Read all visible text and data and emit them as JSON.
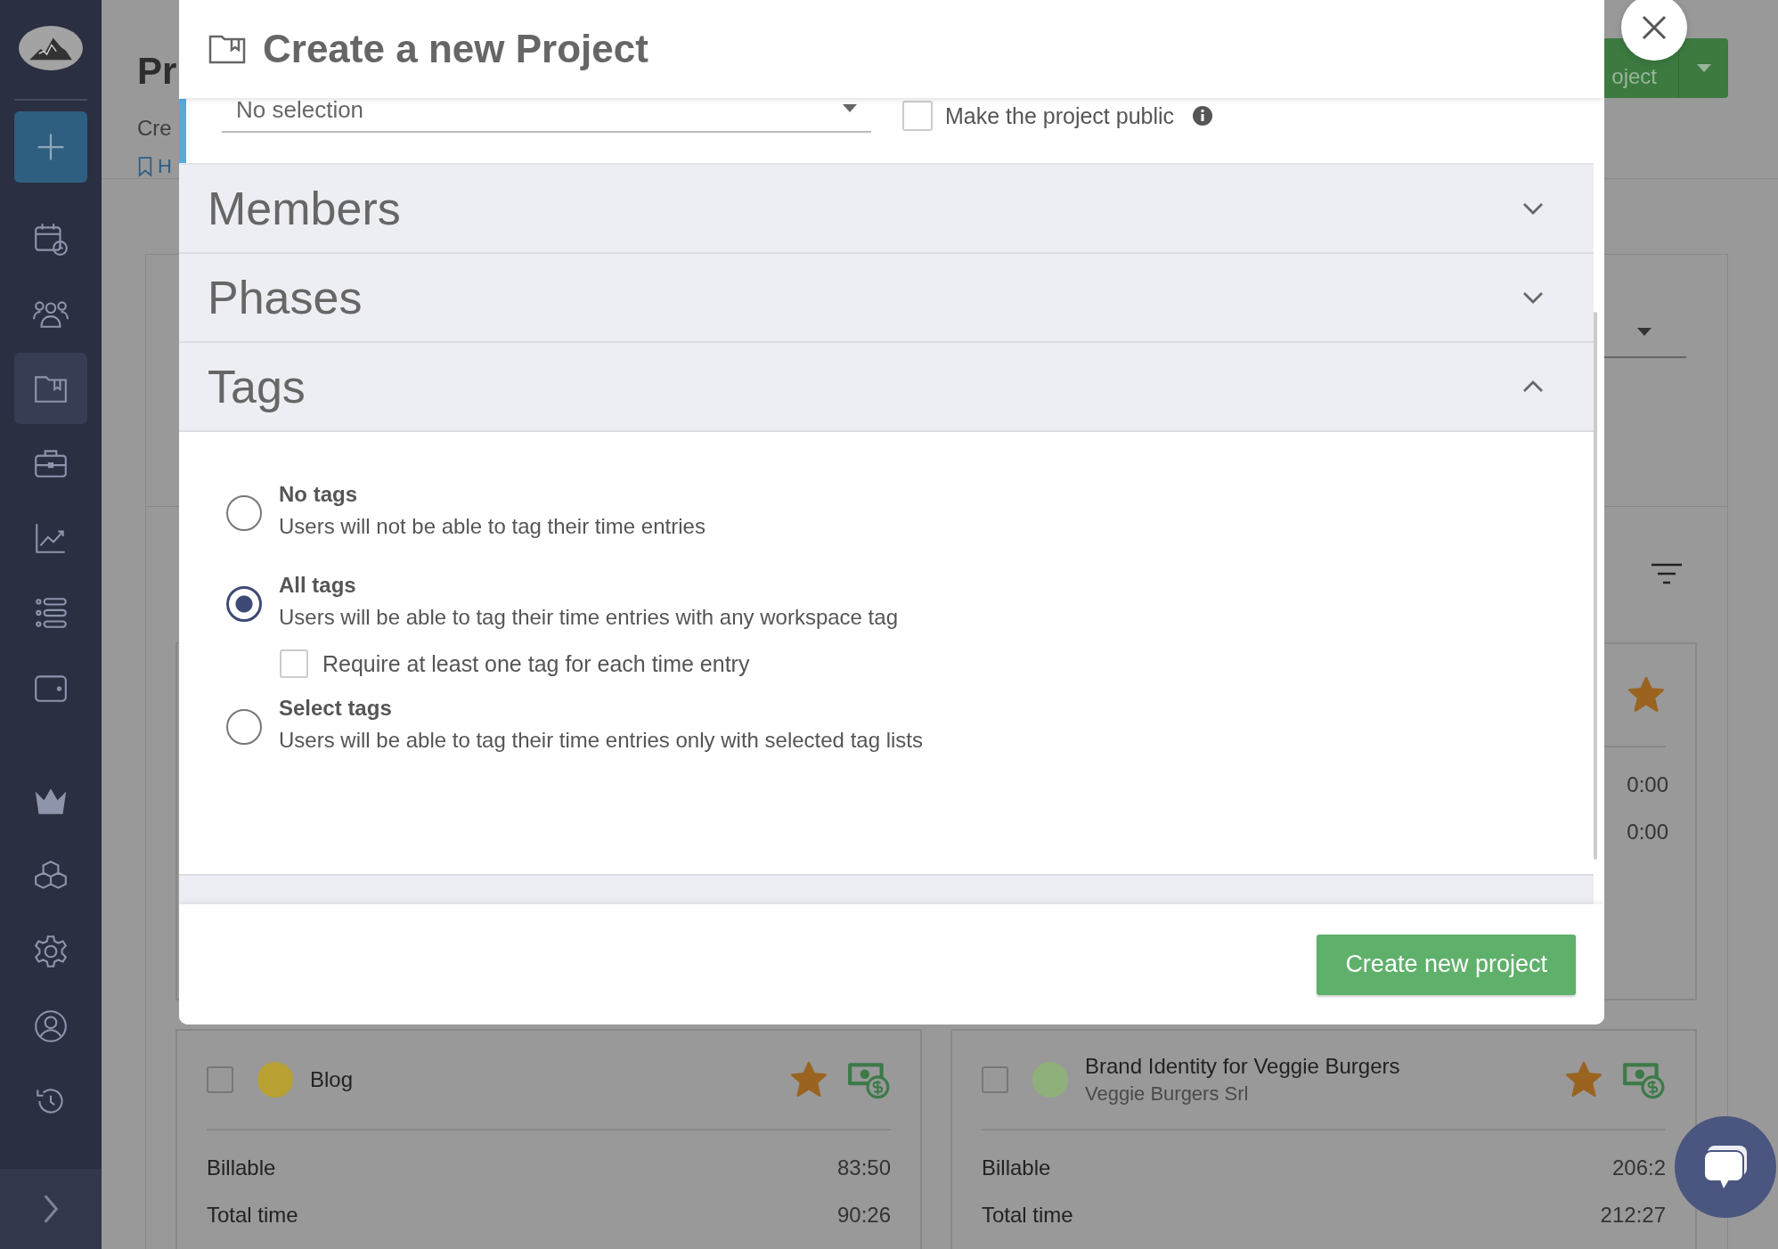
{
  "sidebar": {
    "items": [
      {
        "kind": "calendar",
        "selected": false
      },
      {
        "kind": "team",
        "selected": false
      },
      {
        "kind": "projects",
        "selected": true
      },
      {
        "kind": "briefcase",
        "selected": false
      },
      {
        "kind": "reports",
        "selected": false
      },
      {
        "kind": "list",
        "selected": false
      },
      {
        "kind": "wallet",
        "selected": false
      }
    ],
    "extra_items": [
      {
        "kind": "crown",
        "selected": false
      },
      {
        "kind": "cubes",
        "selected": false
      },
      {
        "kind": "settings",
        "selected": false
      },
      {
        "kind": "profile",
        "selected": false
      },
      {
        "kind": "history",
        "selected": false
      }
    ]
  },
  "page": {
    "title": "Pr",
    "subtitle": "Cre",
    "link": "H",
    "primary_button": "oject"
  },
  "cards": [
    {
      "starred": true,
      "billable": "0:00",
      "total": "0:00"
    },
    {
      "name": "Blog",
      "selected": false,
      "color": "#b8a032",
      "starred": true,
      "billable_label": "Billable",
      "billable": "83:50",
      "total_label": "Total time",
      "total": "90:26"
    },
    {
      "name": "Brand Identity for Veggie Burgers",
      "client": "Veggie Burgers Srl",
      "selected": false,
      "color": "#8fb07a",
      "starred": true,
      "billable_label": "Billable",
      "billable": "206:2",
      "total_label": "Total time",
      "total": "212:27"
    }
  ],
  "modal": {
    "title": "Create a new Project",
    "select_value": "No selection",
    "public_checkbox": {
      "label": "Make the project public",
      "checked": false
    },
    "sections": [
      {
        "title": "Members",
        "expanded": false
      },
      {
        "title": "Phases",
        "expanded": false
      },
      {
        "title": "Tags",
        "expanded": true
      }
    ],
    "tag_options": [
      {
        "title": "No tags",
        "description": "Users will not be able to tag their time entries",
        "selected": false
      },
      {
        "title": "All tags",
        "description": "Users will be able to tag their time entries with any workspace tag",
        "selected": true
      },
      {
        "title": "Select tags",
        "description": "Users will be able to tag their time entries only with selected tag lists",
        "selected": false
      }
    ],
    "require_tag": {
      "label": "Require at least one tag for each time entry",
      "checked": false
    },
    "submit": "Create new project"
  }
}
